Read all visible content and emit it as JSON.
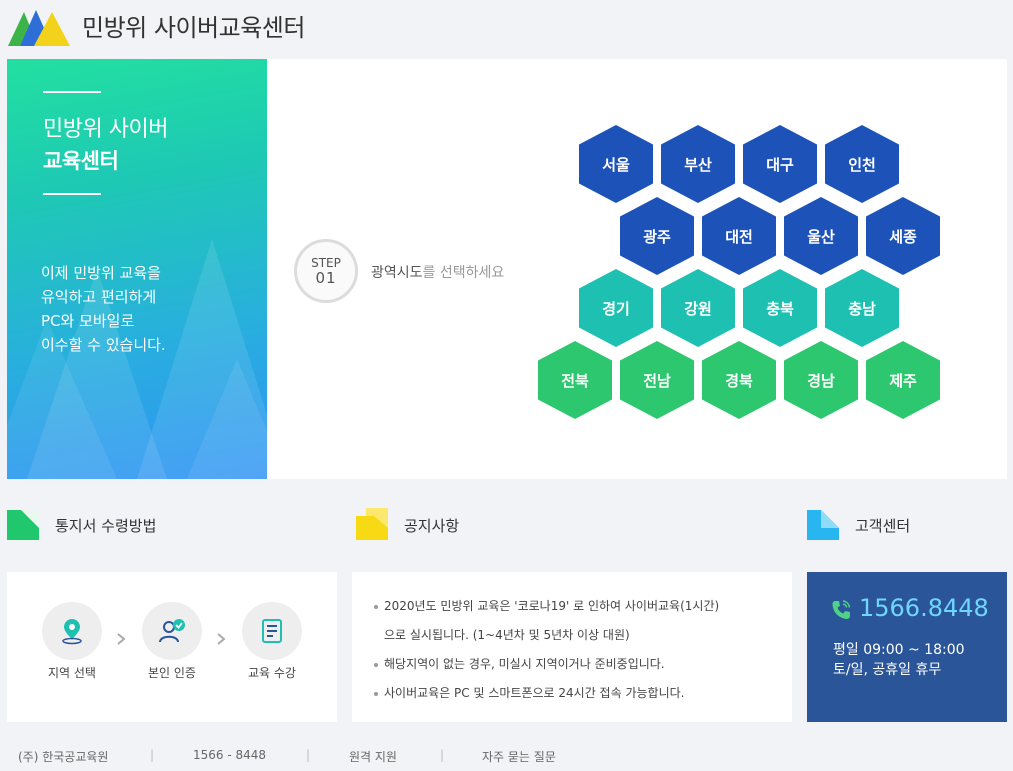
{
  "header": {
    "title": "민방위 사이버교육센터"
  },
  "hero": {
    "title_line1": "민방위 사이버",
    "title_line2": "교육센터",
    "desc": [
      " 이제 민방위 교육을",
      "유익하고 편리하게",
      "PC와 모바일로",
      "이수할 수 있습니다."
    ]
  },
  "step": {
    "label": "STEP",
    "number": "01",
    "text_strong": "광역시도",
    "text_rest": "를 선택하세요"
  },
  "regions": {
    "row1": [
      "서울",
      "부산",
      "대구",
      "인천"
    ],
    "row2": [
      "광주",
      "대전",
      "울산",
      "세종"
    ],
    "row3": [
      "경기",
      "강원",
      "충북",
      "충남"
    ],
    "row4": [
      "전북",
      "전남",
      "경북",
      "경남",
      "제주"
    ]
  },
  "sections": {
    "receipt": {
      "title": "통지서 수령방법",
      "steps": [
        "지역 선택",
        "본인 인증",
        "교육 수강"
      ]
    },
    "notice": {
      "title": "공지사항",
      "items": [
        "2020년도 민방위 교육은 '코로나19' 로 인하여 사이버교육(1시간)",
        "으로 실시됩니다. (1~4년차 및 5년차 이상 대원)",
        "해당지역이 없는 경우, 미실시 지역이거나 준비중입니다.",
        "사이버교육은 PC 및 스마트폰으로 24시간 접속 가능합니다."
      ]
    },
    "support": {
      "title": "고객센터",
      "phone": "1566.8448",
      "hours1": "평일 09:00 ~ 18:00",
      "hours2": "토/일, 공휴일 휴무"
    }
  },
  "footer": {
    "company": "(주) 한국공교육원",
    "phone": "1566 - 8448",
    "remote": "원격 지원",
    "faq": "자주 묻는 질문",
    "sep": "|"
  },
  "colors": {
    "blue": "#1d53b8",
    "teal": "#1ec1b1",
    "green": "#2dc76f",
    "support_bg": "#2a5599"
  }
}
